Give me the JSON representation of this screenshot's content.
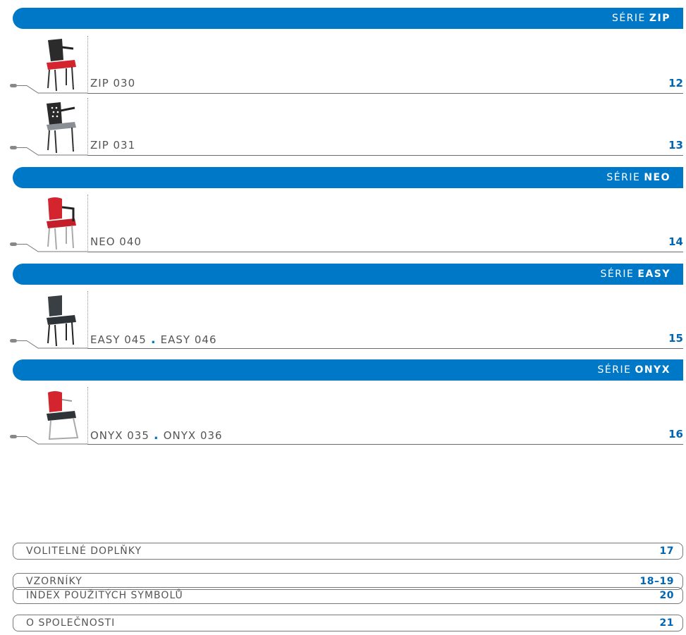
{
  "series": [
    {
      "prefix": "SÉRIE",
      "name": "ZIP"
    },
    {
      "prefix": "SÉRIE",
      "name": "NEO"
    },
    {
      "prefix": "SÉRIE",
      "name": "EASY"
    },
    {
      "prefix": "SÉRIE",
      "name": "ONYX"
    }
  ],
  "products": [
    {
      "name": "ZIP 030",
      "page": "12"
    },
    {
      "name": "ZIP 031",
      "page": "13"
    },
    {
      "name": "NEO 040",
      "page": "14"
    },
    {
      "name_a": "EASY 045",
      "name_b": "EASY 046",
      "page": "15"
    },
    {
      "name_a": "ONYX 035",
      "name_b": "ONYX 036",
      "page": "16"
    }
  ],
  "separator": ".",
  "extras": [
    {
      "label": "VOLITELNÉ DOPLŇKY",
      "page": "17"
    },
    {
      "label": "VZORNÍKY",
      "page": "18–19"
    },
    {
      "label": "INDEX POUŽITÝCH SYMBOLŮ",
      "page": "20"
    },
    {
      "label": "O SPOLEČNOSTI",
      "page": "21"
    }
  ],
  "colors": {
    "accent": "#0078c8",
    "page_number": "#0066b3"
  }
}
